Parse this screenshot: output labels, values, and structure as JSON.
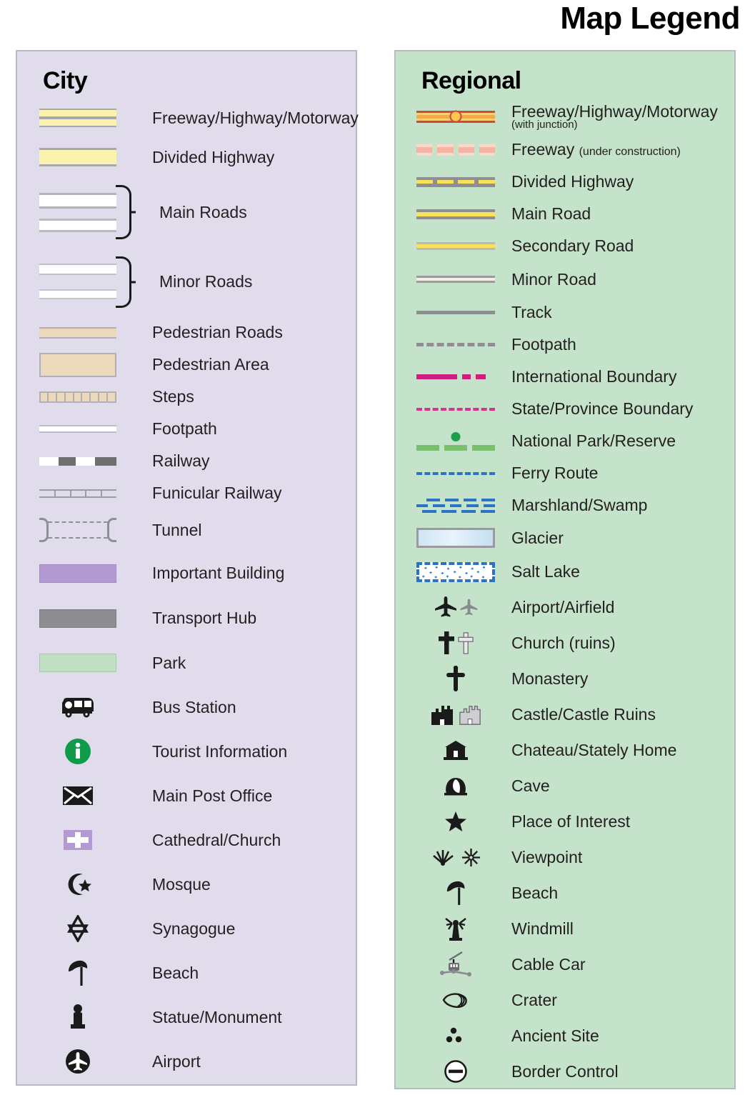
{
  "title": "Map Legend",
  "city": {
    "heading": "City",
    "bg": "#e0dcec",
    "items": [
      {
        "label": "Freeway/Highway/Motorway",
        "icon": "freeway-swatch"
      },
      {
        "label": "Divided Highway",
        "icon": "divided-highway-swatch"
      },
      {
        "label": "Main Roads",
        "icon": "main-roads-swatch"
      },
      {
        "label": "Minor Roads",
        "icon": "minor-roads-swatch"
      },
      {
        "label": "Pedestrian Roads",
        "icon": "pedestrian-roads-swatch"
      },
      {
        "label": "Pedestrian Area",
        "icon": "pedestrian-area-swatch"
      },
      {
        "label": "Steps",
        "icon": "steps-swatch"
      },
      {
        "label": "Footpath",
        "icon": "footpath-swatch"
      },
      {
        "label": "Railway",
        "icon": "railway-swatch"
      },
      {
        "label": "Funicular Railway",
        "icon": "funicular-railway-swatch"
      },
      {
        "label": "Tunnel",
        "icon": "tunnel-swatch"
      },
      {
        "label": "Important Building",
        "icon": "important-building-swatch"
      },
      {
        "label": "Transport Hub",
        "icon": "transport-hub-swatch"
      },
      {
        "label": "Park",
        "icon": "park-swatch"
      },
      {
        "label": "Bus Station",
        "icon": "bus-icon"
      },
      {
        "label": "Tourist Information",
        "icon": "info-icon"
      },
      {
        "label": "Main Post Office",
        "icon": "envelope-icon"
      },
      {
        "label": "Cathedral/Church",
        "icon": "church-cross-icon"
      },
      {
        "label": "Mosque",
        "icon": "star-and-crescent-icon"
      },
      {
        "label": "Synagogue",
        "icon": "star-of-david-icon"
      },
      {
        "label": "Beach",
        "icon": "beach-umbrella-icon"
      },
      {
        "label": "Statue/Monument",
        "icon": "statue-icon"
      },
      {
        "label": "Airport",
        "icon": "airport-circle-icon"
      }
    ],
    "brace_labels": [
      "Main Roads",
      "Minor Roads"
    ],
    "colors": {
      "highway_fill": "#fbf3ad",
      "road_casing": "#a9a9ad",
      "pedestrian_fill": "#ecd9bc",
      "important_building": "#b49ad2",
      "transport_hub": "#8d8d92",
      "park": "#bfe0c3",
      "tourist_info_green": "#0f9b4a"
    }
  },
  "regional": {
    "heading": "Regional",
    "bg": "#c5e3ca",
    "items": [
      {
        "label": "Freeway/Highway/Motorway",
        "sublabel": "(with junction)",
        "icon": "freeway-junction-swatch"
      },
      {
        "label": "Freeway",
        "inline_sub": "(under construction)",
        "icon": "freeway-under-construction-swatch"
      },
      {
        "label": "Divided Highway",
        "icon": "divided-highway-swatch"
      },
      {
        "label": "Main Road",
        "icon": "main-road-swatch"
      },
      {
        "label": "Secondary Road",
        "icon": "secondary-road-swatch"
      },
      {
        "label": "Minor Road",
        "icon": "minor-road-swatch"
      },
      {
        "label": "Track",
        "icon": "track-swatch"
      },
      {
        "label": "Footpath",
        "icon": "footpath-dashed-swatch"
      },
      {
        "label": "International Boundary",
        "icon": "international-boundary-swatch"
      },
      {
        "label": "State/Province Boundary",
        "icon": "state-boundary-swatch"
      },
      {
        "label": "National Park/Reserve",
        "icon": "national-park-swatch"
      },
      {
        "label": "Ferry Route",
        "icon": "ferry-route-swatch"
      },
      {
        "label": "Marshland/Swamp",
        "icon": "marshland-swatch"
      },
      {
        "label": "Glacier",
        "icon": "glacier-swatch"
      },
      {
        "label": "Salt Lake",
        "icon": "salt-lake-swatch"
      },
      {
        "label": "Airport/Airfield",
        "icon": "airplane-icon"
      },
      {
        "label": "Church (ruins)",
        "icon": "cross-icon"
      },
      {
        "label": "Monastery",
        "icon": "orthodox-cross-icon"
      },
      {
        "label": "Castle/Castle Ruins",
        "icon": "castle-icon"
      },
      {
        "label": "Chateau/Stately Home",
        "icon": "chateau-icon"
      },
      {
        "label": "Cave",
        "icon": "cave-icon"
      },
      {
        "label": "Place of Interest",
        "icon": "star-icon"
      },
      {
        "label": "Viewpoint",
        "icon": "viewpoint-icon"
      },
      {
        "label": "Beach",
        "icon": "beach-umbrella-icon"
      },
      {
        "label": "Windmill",
        "icon": "windmill-icon"
      },
      {
        "label": "Cable Car",
        "icon": "cable-car-icon"
      },
      {
        "label": "Crater",
        "icon": "crater-icon"
      },
      {
        "label": "Ancient Site",
        "icon": "ancient-site-icon"
      },
      {
        "label": "Border Control",
        "icon": "border-control-icon"
      }
    ],
    "colors": {
      "freeway_casing": "#cf4843",
      "freeway_fill": "#f5a64f",
      "junction": "#fcc84e",
      "under_construction": "#f5b3a4",
      "road_yellow": "#f7e25a",
      "track_gray": "#8e8e93",
      "intl_boundary": "#cf1f7f",
      "state_boundary": "#d5338d",
      "national_park": "#79c06e",
      "national_park_dot": "#18a04a",
      "ferry_blue": "#2a73c5",
      "glacier": "#cfe5f5"
    }
  }
}
